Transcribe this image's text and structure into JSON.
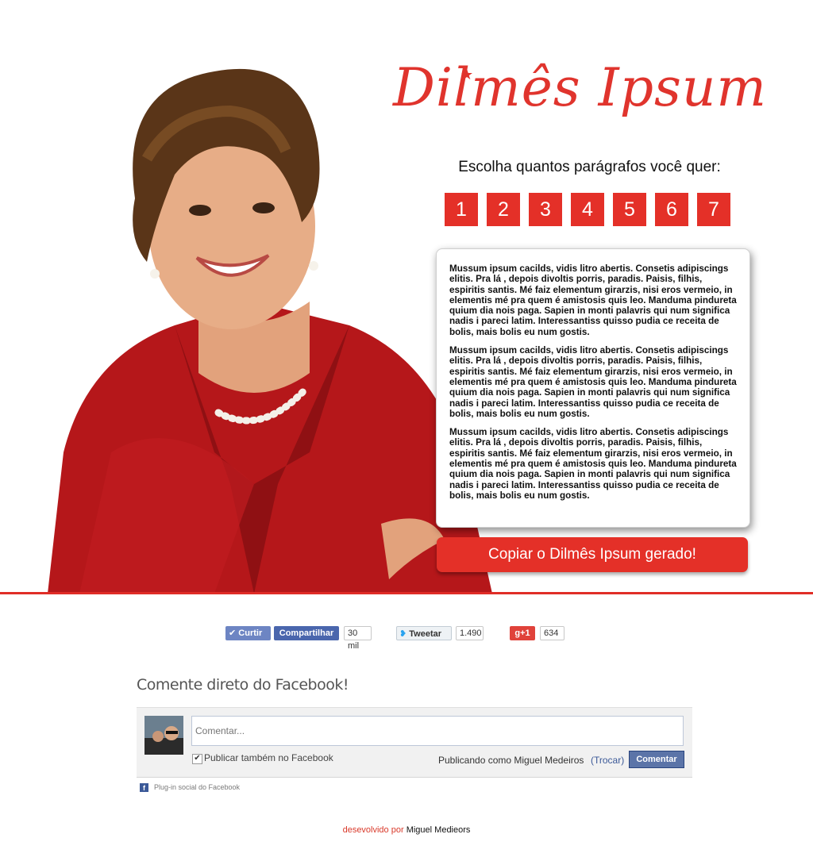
{
  "logo": {
    "text": "Dilmês  Ipsum",
    "star": "★"
  },
  "prompt": "Escolha quantos parágrafos você quer:",
  "paragraph_buttons": [
    "1",
    "2",
    "3",
    "4",
    "5",
    "6",
    "7"
  ],
  "generated_text": {
    "paragraphs": [
      "Mussum ipsum cacilds, vidis litro abertis. Consetis adipiscings elitis. Pra lá , depois divoltis porris, paradis. Paisis, filhis, espiritis santis. Mé faiz elementum girarzis, nisi eros vermeio, in elementis mé pra quem é amistosis quis leo. Manduma pindureta quium dia nois paga. Sapien in monti palavris qui num significa nadis i pareci latim. Interessantiss quisso pudia ce receita de bolis, mais bolis eu num gostis.",
      "Mussum ipsum cacilds, vidis litro abertis. Consetis adipiscings elitis. Pra lá , depois divoltis porris, paradis. Paisis, filhis, espiritis santis. Mé faiz elementum girarzis, nisi eros vermeio, in elementis mé pra quem é amistosis quis leo. Manduma pindureta quium dia nois paga. Sapien in monti palavris qui num significa nadis i pareci latim. Interessantiss quisso pudia ce receita de bolis, mais bolis eu num gostis.",
      "Mussum ipsum cacilds, vidis litro abertis. Consetis adipiscings elitis. Pra lá , depois divoltis porris, paradis. Paisis, filhis, espiritis santis. Mé faiz elementum girarzis, nisi eros vermeio, in elementis mé pra quem é amistosis quis leo. Manduma pindureta quium dia nois paga. Sapien in monti palavris qui num significa nadis i pareci latim. Interessantiss quisso pudia ce receita de bolis, mais bolis eu num gostis."
    ]
  },
  "copy_button": "Copiar o Dilmês Ipsum gerado!",
  "social": {
    "fb_like": "Curtir",
    "fb_share": "Compartilhar",
    "fb_count": "30 mil",
    "tweet": "Tweetar",
    "tweet_count": "1.490",
    "gplus": "g+1",
    "gplus_count": "634"
  },
  "comments": {
    "heading": "Comente direto do Facebook!",
    "placeholder": "Comentar...",
    "publish_label": "Publicar também no Facebook",
    "posting_as": "Publicando como Miguel Medeiros",
    "change": "(Trocar)",
    "submit": "Comentar",
    "plugin_note": "Plug-in social do Facebook"
  },
  "footer": {
    "prefix": "desevolvido por",
    "name": "Miguel Medieors"
  },
  "colors": {
    "accent": "#e43028",
    "facebook": "#3b5998"
  }
}
